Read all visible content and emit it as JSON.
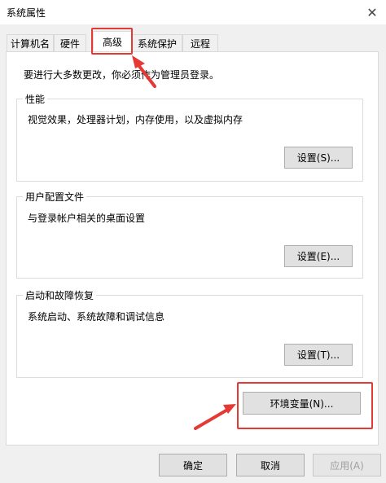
{
  "window": {
    "title": "系统属性"
  },
  "tabs": [
    {
      "label": "计算机名"
    },
    {
      "label": "硬件"
    },
    {
      "label": "高级"
    },
    {
      "label": "系统保护"
    },
    {
      "label": "远程"
    }
  ],
  "active_tab": "高级",
  "intro_text": "要进行大多数更改，你必须作为管理员登录。",
  "groups": {
    "performance": {
      "label": "性能",
      "description": "视觉效果，处理器计划，内存使用，以及虚拟内存",
      "button": "设置(S)..."
    },
    "user_profiles": {
      "label": "用户配置文件",
      "description": "与登录帐户相关的桌面设置",
      "button": "设置(E)..."
    },
    "startup_recovery": {
      "label": "启动和故障恢复",
      "description": "系统启动、系统故障和调试信息",
      "button": "设置(T)..."
    }
  },
  "env_button": "环境变量(N)...",
  "dialog_buttons": {
    "ok": "确定",
    "cancel": "取消",
    "apply": "应用(A)"
  },
  "annotation_color": "#e53935",
  "icons": {
    "close": "close-icon"
  }
}
